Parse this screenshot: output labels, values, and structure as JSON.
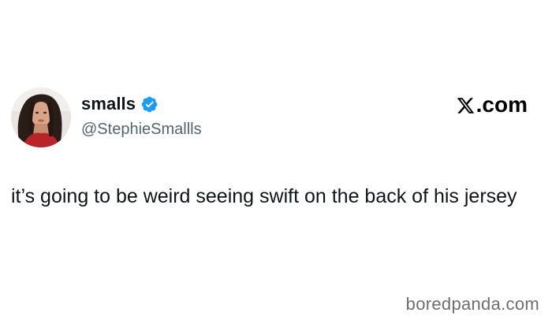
{
  "tweet": {
    "display_name": "smalls",
    "handle": "@StephieSmallls",
    "text": "it’s going to be weird seeing swift on the back of his jersey",
    "verified_icon": "verified-badge-icon",
    "verified_color": "#1d9bf0"
  },
  "brand": {
    "site": ".com",
    "logo_icon": "x-logo-icon"
  },
  "watermark": {
    "text": "boredpanda.com"
  }
}
